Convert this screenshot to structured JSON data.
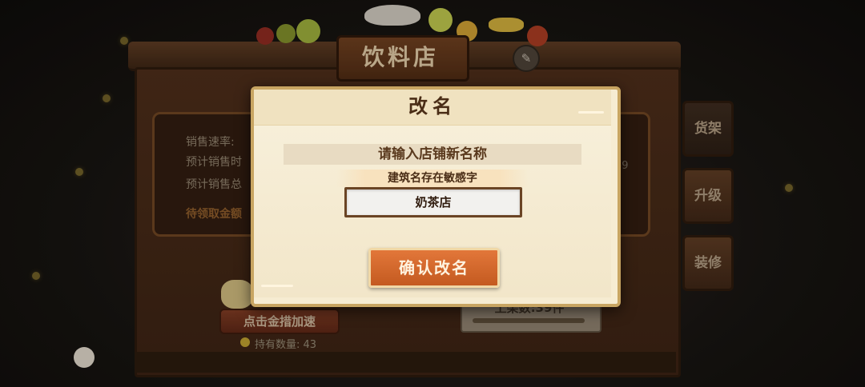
{
  "shop": {
    "title": "饮料店",
    "edit_icon": "pencil-icon",
    "stats": {
      "sales_speed_label": "销售速率:",
      "est_sales_time_label": "预计销售时",
      "est_sales_total_label": "预计销售总",
      "pending_gold_label": "待领取金额",
      "right_value": "59"
    },
    "side_tabs": [
      "货架",
      "升级",
      "装修"
    ],
    "speed_button": "点击金措加速",
    "hold_label": "持有数量: 43",
    "shelf_count": "上架数:39件"
  },
  "dialog": {
    "title": "改名",
    "prompt": "请输入店铺新名称",
    "warning": "建筑名存在敏感字",
    "input_value": "奶茶店",
    "confirm_label": "确认改名"
  },
  "colors": {
    "dialog_bg": "#f6ecd2",
    "button_orange": "#d2662c",
    "title_brown": "#4a2d16"
  }
}
